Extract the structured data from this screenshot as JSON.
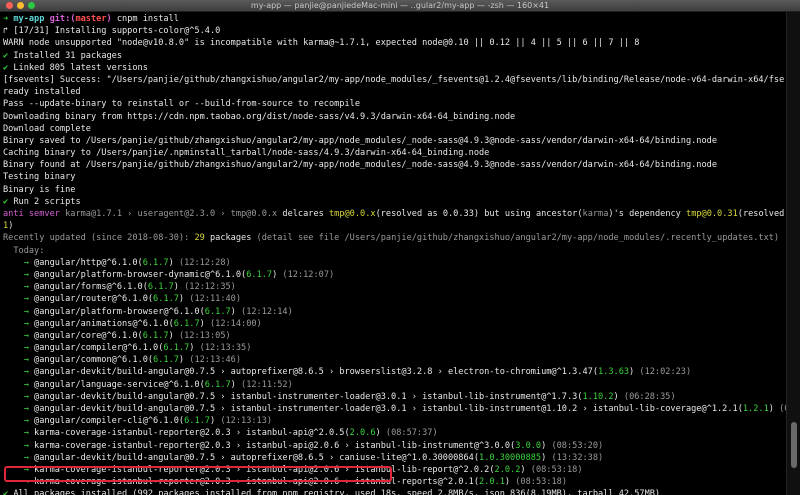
{
  "window": {
    "title": "my-app — panjie@panjiedeMac-mini — ..gular2/my-app — -zsh — 160×41"
  },
  "lines": [
    [
      {
        "t": "➜ ",
        "c": "t-green t-bold"
      },
      {
        "t": "my-app ",
        "c": "t-cyan t-bold"
      },
      {
        "t": "git:(",
        "c": "t-magenta t-bold"
      },
      {
        "t": "master",
        "c": "t-red t-bold"
      },
      {
        "t": ")",
        "c": "t-magenta t-bold"
      },
      {
        "t": " cnpm install",
        "c": "t-white"
      }
    ],
    [
      {
        "t": "↱ [17/31] Installing supports-color@^5.4.0",
        "c": "t-white"
      }
    ],
    [
      {
        "t": "WARN node unsupported ",
        "c": "t-white"
      },
      {
        "t": "\"node@v10.8.0\" is incompatible with karma@~1.7.1, expected node@0.10 || 0.12 || 4 || 5 || 6 || 7 || 8",
        "c": "t-white"
      }
    ],
    [
      {
        "t": "✔ ",
        "c": "t-green"
      },
      {
        "t": "Installed 31 packages",
        "c": "t-white"
      }
    ],
    [
      {
        "t": "✔ ",
        "c": "t-green"
      },
      {
        "t": "Linked 805 latest versions",
        "c": "t-white"
      }
    ],
    [
      {
        "t": "[fsevents] Success: \"/Users/panjie/github/zhangxishuo/angular2/my-app/node_modules/_fsevents@1.2.4@fsevents/lib/binding/Release/node-v64-darwin-x64/fse.node\" al",
        "c": "t-white"
      }
    ],
    [
      {
        "t": "ready installed",
        "c": "t-white"
      }
    ],
    [
      {
        "t": "Pass --update-binary to reinstall or --build-from-source to recompile",
        "c": "t-white"
      }
    ],
    [
      {
        "t": "Downloading binary from https://cdn.npm.taobao.org/dist/node-sass/v4.9.3/darwin-x64-64_binding.node",
        "c": "t-white"
      }
    ],
    [
      {
        "t": "Download complete",
        "c": "t-white"
      }
    ],
    [
      {
        "t": "Binary saved to /Users/panjie/github/zhangxishuo/angular2/my-app/node_modules/_node-sass@4.9.3@node-sass/vendor/darwin-x64-64/binding.node",
        "c": "t-white"
      }
    ],
    [
      {
        "t": "Caching binary to /Users/panjie/.npminstall_tarball/node-sass/4.9.3/darwin-x64-64_binding.node",
        "c": "t-white"
      }
    ],
    [
      {
        "t": "Binary found at /Users/panjie/github/zhangxishuo/angular2/my-app/node_modules/_node-sass@4.9.3@node-sass/vendor/darwin-x64-64/binding.node",
        "c": "t-white"
      }
    ],
    [
      {
        "t": "Testing binary",
        "c": "t-white"
      }
    ],
    [
      {
        "t": "Binary is fine",
        "c": "t-white"
      }
    ],
    [
      {
        "t": "✔ ",
        "c": "t-green"
      },
      {
        "t": "Run 2 scripts",
        "c": "t-white"
      }
    ],
    [
      {
        "t": "anti semver ",
        "c": "t-magenta"
      },
      {
        "t": "karma@1.7.1 › useragent@2.3.0 › tmp@0.0.x ",
        "c": "t-gray"
      },
      {
        "t": "delcares ",
        "c": "t-white"
      },
      {
        "t": "tmp@0.0.x",
        "c": "t-yellow"
      },
      {
        "t": "(resolved as 0.0.33) but using ancestor(",
        "c": "t-white"
      },
      {
        "t": "karma",
        "c": "t-gray"
      },
      {
        "t": ")'s dependency ",
        "c": "t-white"
      },
      {
        "t": "tmp@0.0.31",
        "c": "t-yellow"
      },
      {
        "t": "(resolved as ",
        "c": "t-white"
      },
      {
        "t": "0.0.3",
        "c": "t-yellow"
      }
    ],
    [
      {
        "t": "1",
        "c": "t-yellow"
      },
      {
        "t": ")",
        "c": "t-white"
      }
    ],
    [
      {
        "t": "Recently updated (since 2018-08-30): ",
        "c": "t-gray"
      },
      {
        "t": "29",
        "c": "t-yellow"
      },
      {
        "t": " packages ",
        "c": "t-white"
      },
      {
        "t": "(detail see file /Users/panjie/github/zhangxishuo/angular2/my-app/node_modules/.recently_updates.txt)",
        "c": "t-gray"
      }
    ],
    [
      {
        "t": "  Today:",
        "c": "t-gray"
      }
    ],
    [
      {
        "t": "    → ",
        "c": "t-arrow"
      },
      {
        "t": "@angular/http@^6.1.0(",
        "c": "t-white"
      },
      {
        "t": "6.1.7",
        "c": "t-green"
      },
      {
        "t": ") ",
        "c": "t-white"
      },
      {
        "t": "(12:12:28)",
        "c": "t-gray"
      }
    ],
    [
      {
        "t": "    → ",
        "c": "t-arrow"
      },
      {
        "t": "@angular/platform-browser-dynamic@^6.1.0(",
        "c": "t-white"
      },
      {
        "t": "6.1.7",
        "c": "t-green"
      },
      {
        "t": ") ",
        "c": "t-white"
      },
      {
        "t": "(12:12:07)",
        "c": "t-gray"
      }
    ],
    [
      {
        "t": "    → ",
        "c": "t-arrow"
      },
      {
        "t": "@angular/forms@^6.1.0(",
        "c": "t-white"
      },
      {
        "t": "6.1.7",
        "c": "t-green"
      },
      {
        "t": ") ",
        "c": "t-white"
      },
      {
        "t": "(12:12:35)",
        "c": "t-gray"
      }
    ],
    [
      {
        "t": "    → ",
        "c": "t-arrow"
      },
      {
        "t": "@angular/router@^6.1.0(",
        "c": "t-white"
      },
      {
        "t": "6.1.7",
        "c": "t-green"
      },
      {
        "t": ") ",
        "c": "t-white"
      },
      {
        "t": "(12:11:40)",
        "c": "t-gray"
      }
    ],
    [
      {
        "t": "    → ",
        "c": "t-arrow"
      },
      {
        "t": "@angular/platform-browser@^6.1.0(",
        "c": "t-white"
      },
      {
        "t": "6.1.7",
        "c": "t-green"
      },
      {
        "t": ") ",
        "c": "t-white"
      },
      {
        "t": "(12:12:14)",
        "c": "t-gray"
      }
    ],
    [
      {
        "t": "    → ",
        "c": "t-arrow"
      },
      {
        "t": "@angular/animations@^6.1.0(",
        "c": "t-white"
      },
      {
        "t": "6.1.7",
        "c": "t-green"
      },
      {
        "t": ") ",
        "c": "t-white"
      },
      {
        "t": "(12:14:00)",
        "c": "t-gray"
      }
    ],
    [
      {
        "t": "    → ",
        "c": "t-arrow"
      },
      {
        "t": "@angular/core@^6.1.0(",
        "c": "t-white"
      },
      {
        "t": "6.1.7",
        "c": "t-green"
      },
      {
        "t": ") ",
        "c": "t-white"
      },
      {
        "t": "(12:13:05)",
        "c": "t-gray"
      }
    ],
    [
      {
        "t": "    → ",
        "c": "t-arrow"
      },
      {
        "t": "@angular/compiler@^6.1.0(",
        "c": "t-white"
      },
      {
        "t": "6.1.7",
        "c": "t-green"
      },
      {
        "t": ") ",
        "c": "t-white"
      },
      {
        "t": "(12:13:35)",
        "c": "t-gray"
      }
    ],
    [
      {
        "t": "    → ",
        "c": "t-arrow"
      },
      {
        "t": "@angular/common@^6.1.0(",
        "c": "t-white"
      },
      {
        "t": "6.1.7",
        "c": "t-green"
      },
      {
        "t": ") ",
        "c": "t-white"
      },
      {
        "t": "(12:13:46)",
        "c": "t-gray"
      }
    ],
    [
      {
        "t": "    → ",
        "c": "t-arrow"
      },
      {
        "t": "@angular-devkit/build-angular@0.7.5 › autoprefixer@8.6.5 › browserslist@3.2.8 › electron-to-chromium@^1.3.47(",
        "c": "t-white"
      },
      {
        "t": "1.3.63",
        "c": "t-green"
      },
      {
        "t": ") ",
        "c": "t-white"
      },
      {
        "t": "(12:02:23)",
        "c": "t-gray"
      }
    ],
    [
      {
        "t": "    → ",
        "c": "t-arrow"
      },
      {
        "t": "@angular/language-service@^6.1.0(",
        "c": "t-white"
      },
      {
        "t": "6.1.7",
        "c": "t-green"
      },
      {
        "t": ") ",
        "c": "t-white"
      },
      {
        "t": "(12:11:52)",
        "c": "t-gray"
      }
    ],
    [
      {
        "t": "    → ",
        "c": "t-arrow"
      },
      {
        "t": "@angular-devkit/build-angular@0.7.5 › istanbul-instrumenter-loader@3.0.1 › istanbul-lib-instrument@^1.7.3(",
        "c": "t-white"
      },
      {
        "t": "1.10.2",
        "c": "t-green"
      },
      {
        "t": ") ",
        "c": "t-white"
      },
      {
        "t": "(06:28:35)",
        "c": "t-gray"
      }
    ],
    [
      {
        "t": "    → ",
        "c": "t-arrow"
      },
      {
        "t": "@angular-devkit/build-angular@0.7.5 › istanbul-instrumenter-loader@3.0.1 › istanbul-lib-instrument@1.10.2 › istanbul-lib-coverage@^1.2.1(",
        "c": "t-white"
      },
      {
        "t": "1.2.1",
        "c": "t-green"
      },
      {
        "t": ") ",
        "c": "t-white"
      },
      {
        "t": "(06:28:24)",
        "c": "t-gray"
      }
    ],
    [
      {
        "t": "    → ",
        "c": "t-arrow"
      },
      {
        "t": "@angular/compiler-cli@^6.1.0(",
        "c": "t-white"
      },
      {
        "t": "6.1.7",
        "c": "t-green"
      },
      {
        "t": ") ",
        "c": "t-white"
      },
      {
        "t": "(12:13:13)",
        "c": "t-gray"
      }
    ],
    [
      {
        "t": "    → ",
        "c": "t-arrow"
      },
      {
        "t": "karma-coverage-istanbul-reporter@2.0.3 › istanbul-api@^2.0.5(",
        "c": "t-white"
      },
      {
        "t": "2.0.6",
        "c": "t-green"
      },
      {
        "t": ") ",
        "c": "t-white"
      },
      {
        "t": "(08:57:37)",
        "c": "t-gray"
      }
    ],
    [
      {
        "t": "    → ",
        "c": "t-arrow"
      },
      {
        "t": "karma-coverage-istanbul-reporter@2.0.3 › istanbul-api@2.0.6 › istanbul-lib-instrument@^3.0.0(",
        "c": "t-white"
      },
      {
        "t": "3.0.0",
        "c": "t-green"
      },
      {
        "t": ") ",
        "c": "t-white"
      },
      {
        "t": "(08:53:20)",
        "c": "t-gray"
      }
    ],
    [
      {
        "t": "    → ",
        "c": "t-arrow"
      },
      {
        "t": "@angular-devkit/build-angular@0.7.5 › autoprefixer@8.6.5 › caniuse-lite@^1.0.30000864(",
        "c": "t-white"
      },
      {
        "t": "1.0.30000885",
        "c": "t-green"
      },
      {
        "t": ") ",
        "c": "t-white"
      },
      {
        "t": "(13:32:38)",
        "c": "t-gray"
      }
    ],
    [
      {
        "t": "    → ",
        "c": "t-arrow"
      },
      {
        "t": "karma-coverage-istanbul-reporter@2.0.3 › istanbul-api@2.0.6 › istanbul-lib-report@^2.0.2(",
        "c": "t-white"
      },
      {
        "t": "2.0.2",
        "c": "t-green"
      },
      {
        "t": ") ",
        "c": "t-white"
      },
      {
        "t": "(08:53:18)",
        "c": "t-gray"
      }
    ],
    [
      {
        "t": "    → ",
        "c": "t-arrow"
      },
      {
        "t": "karma-coverage-istanbul-reporter@2.0.3 › istanbul-api@2.0.6 › istanbul-reports@^2.0.1(",
        "c": "t-white"
      },
      {
        "t": "2.0.1",
        "c": "t-green"
      },
      {
        "t": ") ",
        "c": "t-white"
      },
      {
        "t": "(08:53:18)",
        "c": "t-gray"
      }
    ],
    [
      {
        "t": "✔ ",
        "c": "t-green"
      },
      {
        "t": "All packages installed (992 packages installed from npm registry, used 18s, speed 2.8MB/s, json 836(8.19MB), tarball 42.57MB)",
        "c": "t-white"
      }
    ],
    [
      {
        "t": "➜ ",
        "c": "t-green t-bold"
      },
      {
        "t": "my-app ",
        "c": "t-cyan t-bold"
      },
      {
        "t": "git:(",
        "c": "t-magenta t-bold"
      },
      {
        "t": "master",
        "c": "t-red t-bold"
      },
      {
        "t": ") ",
        "c": "t-magenta t-bold"
      }
    ]
  ]
}
